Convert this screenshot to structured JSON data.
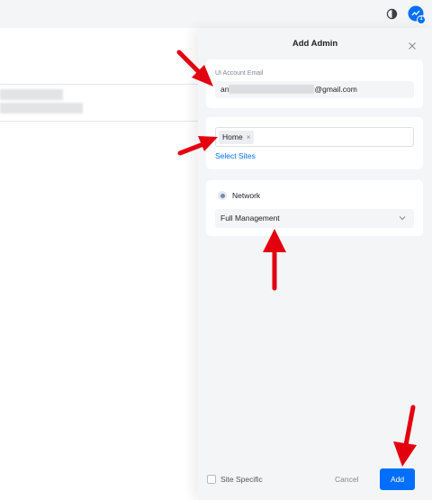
{
  "top_bar": {
    "icons": [
      "theme-toggle-icon",
      "cloud-notification-icon"
    ],
    "notification_count": "1"
  },
  "panel": {
    "title": "Add Admin",
    "email_section": {
      "label": "UI Account Email",
      "value_prefix": "an",
      "value_suffix": "@gmail.com"
    },
    "sites_section": {
      "chips": [
        {
          "label": "Home",
          "remove_symbol": "×"
        }
      ],
      "select_link": "Select Sites"
    },
    "role_section": {
      "app_name": "Network",
      "role_value": "Full Management"
    },
    "footer": {
      "checkbox_label": "Site Specific",
      "cancel_label": "Cancel",
      "add_label": "Add"
    }
  },
  "colors": {
    "accent": "#006fff",
    "annotation_arrow": "#e3000f"
  }
}
